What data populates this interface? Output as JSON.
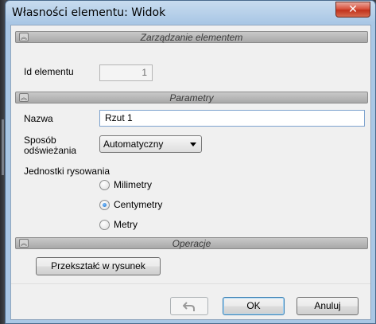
{
  "window": {
    "title": "Własności elementu: Widok",
    "close_glyph": "✕"
  },
  "sections": {
    "management": {
      "title": "Zarządzanie elementem",
      "chevron": "︽"
    },
    "parameters": {
      "title": "Parametry",
      "chevron": "︽"
    },
    "operations": {
      "title": "Operacje",
      "chevron": "︽"
    }
  },
  "management": {
    "id_label": "Id elementu",
    "id_value": "1"
  },
  "parameters": {
    "name_label": "Nazwa",
    "name_value": "Rzut 1",
    "refresh_label_line1": "Sposób",
    "refresh_label_line2": "odświeżania",
    "refresh_value": "Automatyczny",
    "units_label": "Jednostki rysowania",
    "units": [
      {
        "label": "Milimetry",
        "checked": false
      },
      {
        "label": "Centymetry",
        "checked": true
      },
      {
        "label": "Metry",
        "checked": false
      }
    ]
  },
  "operations": {
    "convert_button": "Przekształć w rysunek"
  },
  "footer": {
    "undo_icon": "undo-icon",
    "ok": "OK",
    "cancel": "Anuluj"
  },
  "colors": {
    "title_bar": "#a9c7e5",
    "close_button": "#c1321c",
    "section_header": "#b5b5b5"
  }
}
